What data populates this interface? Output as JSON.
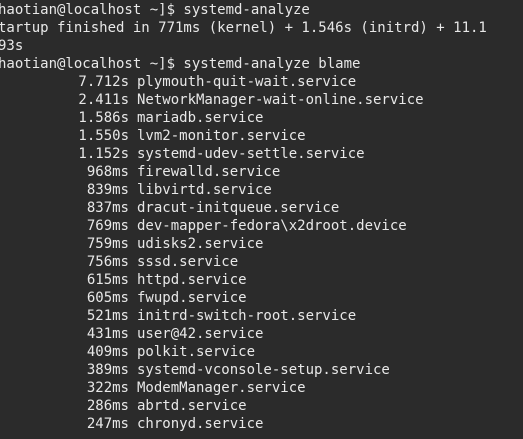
{
  "terminal": {
    "lines": [
      "haotian@localhost ~]$ systemd-analyze",
      "tartup finished in 771ms (kernel) + 1.546s (initrd) + 11.1",
      "93s",
      "haotian@localhost ~]$ systemd-analyze blame"
    ],
    "blame": [
      {
        "time": "7.712s",
        "unit": "plymouth-quit-wait.service"
      },
      {
        "time": "2.411s",
        "unit": "NetworkManager-wait-online.service"
      },
      {
        "time": "1.586s",
        "unit": "mariadb.service"
      },
      {
        "time": "1.550s",
        "unit": "lvm2-monitor.service"
      },
      {
        "time": "1.152s",
        "unit": "systemd-udev-settle.service"
      },
      {
        "time": "968ms",
        "unit": "firewalld.service"
      },
      {
        "time": "839ms",
        "unit": "libvirtd.service"
      },
      {
        "time": "837ms",
        "unit": "dracut-initqueue.service"
      },
      {
        "time": "769ms",
        "unit": "dev-mapper-fedora\\x2droot.device"
      },
      {
        "time": "759ms",
        "unit": "udisks2.service"
      },
      {
        "time": "756ms",
        "unit": "sssd.service"
      },
      {
        "time": "615ms",
        "unit": "httpd.service"
      },
      {
        "time": "605ms",
        "unit": "fwupd.service"
      },
      {
        "time": "521ms",
        "unit": "initrd-switch-root.service"
      },
      {
        "time": "431ms",
        "unit": "user@42.service"
      },
      {
        "time": "409ms",
        "unit": "polkit.service"
      },
      {
        "time": "389ms",
        "unit": "systemd-vconsole-setup.service"
      },
      {
        "time": "322ms",
        "unit": "ModemManager.service"
      },
      {
        "time": "286ms",
        "unit": "abrtd.service"
      },
      {
        "time": "247ms",
        "unit": "chronyd.service"
      }
    ]
  }
}
